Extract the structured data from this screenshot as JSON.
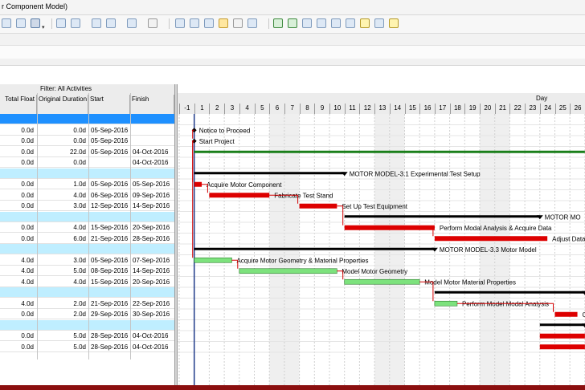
{
  "window": {
    "title": "r Component Model)"
  },
  "filter": {
    "label": "Filter: All Activities"
  },
  "columns": [
    "Total Float",
    "Original Duration",
    "Start",
    "Finish"
  ],
  "timescale": {
    "unit_label": "Day",
    "days": [
      "-1",
      "1",
      "2",
      "3",
      "4",
      "5",
      "6",
      "7",
      "8",
      "9",
      "10",
      "11",
      "12",
      "13",
      "14",
      "15",
      "16",
      "17",
      "18",
      "19",
      "20",
      "21",
      "22",
      "23",
      "24",
      "25",
      "26"
    ]
  },
  "rows": [
    {
      "type": "band",
      "color": "#1e90ff",
      "tf": "",
      "od": "",
      "start": "",
      "finish": ""
    },
    {
      "type": "act",
      "tf": "0.0d",
      "od": "0.0d",
      "start": "05-Sep-2016",
      "finish": ""
    },
    {
      "type": "act",
      "tf": "0.0d",
      "od": "0.0d",
      "start": "05-Sep-2016",
      "finish": ""
    },
    {
      "type": "act",
      "tf": "0.0d",
      "od": "22.0d",
      "start": "05-Sep-2016",
      "finish": "04-Oct-2016"
    },
    {
      "type": "act",
      "tf": "0.0d",
      "od": "0.0d",
      "start": "",
      "finish": "04-Oct-2016"
    },
    {
      "type": "band",
      "color": "#bfeeff",
      "tf": "",
      "od": "",
      "start": "",
      "finish": ""
    },
    {
      "type": "act",
      "tf": "0.0d",
      "od": "1.0d",
      "start": "05-Sep-2016",
      "finish": "05-Sep-2016"
    },
    {
      "type": "act",
      "tf": "0.0d",
      "od": "4.0d",
      "start": "06-Sep-2016",
      "finish": "09-Sep-2016"
    },
    {
      "type": "act",
      "tf": "0.0d",
      "od": "3.0d",
      "start": "12-Sep-2016",
      "finish": "14-Sep-2016"
    },
    {
      "type": "band",
      "color": "#bfeeff",
      "tf": "",
      "od": "",
      "start": "",
      "finish": ""
    },
    {
      "type": "act",
      "tf": "0.0d",
      "od": "4.0d",
      "start": "15-Sep-2016",
      "finish": "20-Sep-2016"
    },
    {
      "type": "act",
      "tf": "0.0d",
      "od": "6.0d",
      "start": "21-Sep-2016",
      "finish": "28-Sep-2016"
    },
    {
      "type": "band",
      "color": "#bfeeff",
      "tf": "",
      "od": "",
      "start": "",
      "finish": ""
    },
    {
      "type": "act",
      "tf": "4.0d",
      "od": "3.0d",
      "start": "05-Sep-2016",
      "finish": "07-Sep-2016"
    },
    {
      "type": "act",
      "tf": "4.0d",
      "od": "5.0d",
      "start": "08-Sep-2016",
      "finish": "14-Sep-2016"
    },
    {
      "type": "act",
      "tf": "4.0d",
      "od": "4.0d",
      "start": "15-Sep-2016",
      "finish": "20-Sep-2016"
    },
    {
      "type": "band",
      "color": "#bfeeff",
      "tf": "",
      "od": "",
      "start": "",
      "finish": ""
    },
    {
      "type": "act",
      "tf": "4.0d",
      "od": "2.0d",
      "start": "21-Sep-2016",
      "finish": "22-Sep-2016"
    },
    {
      "type": "act",
      "tf": "0.0d",
      "od": "2.0d",
      "start": "29-Sep-2016",
      "finish": "30-Sep-2016"
    },
    {
      "type": "band",
      "color": "#bfeeff",
      "tf": "",
      "od": "",
      "start": "",
      "finish": ""
    },
    {
      "type": "act",
      "tf": "0.0d",
      "od": "5.0d",
      "start": "28-Sep-2016",
      "finish": "04-Oct-2016"
    },
    {
      "type": "act",
      "tf": "0.0d",
      "od": "5.0d",
      "start": "28-Sep-2016",
      "finish": "04-Oct-2016"
    }
  ],
  "gantt": {
    "items": [
      {
        "row": 1,
        "kind": "milestone",
        "start": 1,
        "label": "Notice to Proceed"
      },
      {
        "row": 2,
        "kind": "milestone",
        "start": 1,
        "label": "Start Project"
      },
      {
        "row": 3,
        "kind": "bar",
        "color": "#1a7f1a",
        "start": 1,
        "end": 27,
        "label": ""
      },
      {
        "row": 5,
        "kind": "summary",
        "start": 1,
        "end": 11,
        "label": "MOTOR MODEL-3.1  Experimental Test Setup"
      },
      {
        "row": 6,
        "kind": "bar",
        "color": "#dd0000",
        "start": 1,
        "end": 1.5,
        "label": "Acquire Motor Component"
      },
      {
        "row": 7,
        "kind": "bar",
        "color": "#dd0000",
        "start": 2,
        "end": 6,
        "label": "Fabricate Test Stand"
      },
      {
        "row": 8,
        "kind": "bar",
        "color": "#dd0000",
        "start": 8,
        "end": 10.5,
        "label": "Set Up Test Equipment"
      },
      {
        "row": 9,
        "kind": "summary",
        "start": 11,
        "end": 24,
        "label": "MOTOR MO"
      },
      {
        "row": 10,
        "kind": "bar",
        "color": "#dd0000",
        "start": 11,
        "end": 17,
        "label": "Perform Modal Analysis & Acquire Data"
      },
      {
        "row": 11,
        "kind": "bar",
        "color": "#dd0000",
        "start": 17,
        "end": 24.5,
        "label": "Adjust Data"
      },
      {
        "row": 12,
        "kind": "summary",
        "start": 1,
        "end": 17,
        "label": "MOTOR MODEL-3.3  Motor Model"
      },
      {
        "row": 13,
        "kind": "bar",
        "color": "#7de27d",
        "start": 1,
        "end": 3.5,
        "label": "Acquire Motor Geometry & Material Properties"
      },
      {
        "row": 14,
        "kind": "bar",
        "color": "#7de27d",
        "start": 4,
        "end": 10.5,
        "label": "Model Motor Geometry"
      },
      {
        "row": 15,
        "kind": "bar",
        "color": "#7de27d",
        "start": 11,
        "end": 16,
        "label": "Model Motor Material Properties"
      },
      {
        "row": 16,
        "kind": "summary",
        "start": 17,
        "end": 27,
        "label": "M"
      },
      {
        "row": 17,
        "kind": "bar",
        "color": "#7de27d",
        "start": 17,
        "end": 18.5,
        "label": "Perform Model Modal Analysis"
      },
      {
        "row": 18,
        "kind": "bar",
        "color": "#dd0000",
        "start": 25,
        "end": 26.5,
        "label": "C"
      },
      {
        "row": 19,
        "kind": "summary",
        "start": 24,
        "end": 27,
        "label": ""
      },
      {
        "row": 20,
        "kind": "bar",
        "color": "#dd0000",
        "start": 24,
        "end": 27,
        "label": ""
      },
      {
        "row": 21,
        "kind": "bar",
        "color": "#dd0000",
        "start": 24,
        "end": 27,
        "label": ""
      }
    ]
  }
}
